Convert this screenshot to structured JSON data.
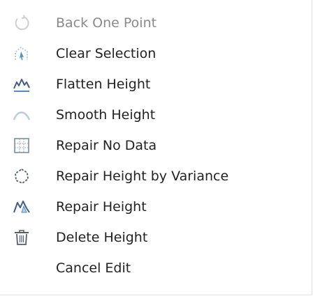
{
  "menu": {
    "items": [
      {
        "label": "Back One Point",
        "icon": "undo-arc-icon",
        "enabled": false
      },
      {
        "label": "Clear Selection",
        "icon": "clear-selection-icon",
        "enabled": true
      },
      {
        "label": "Flatten Height",
        "icon": "flatten-height-icon",
        "enabled": true
      },
      {
        "label": "Smooth Height",
        "icon": "smooth-height-icon",
        "enabled": true
      },
      {
        "label": "Repair No Data",
        "icon": "repair-no-data-icon",
        "enabled": true
      },
      {
        "label": "Repair Height by Variance",
        "icon": "repair-variance-icon",
        "enabled": true
      },
      {
        "label": "Repair Height",
        "icon": "repair-height-icon",
        "enabled": true
      },
      {
        "label": "Delete Height",
        "icon": "trash-icon",
        "enabled": true
      },
      {
        "label": "Cancel Edit",
        "icon": "",
        "enabled": true
      }
    ]
  },
  "colors": {
    "text": "#222222",
    "disabled_text": "#8a8a8a",
    "icon_blue": "#4a8fc8",
    "icon_light": "#b9cde0"
  }
}
